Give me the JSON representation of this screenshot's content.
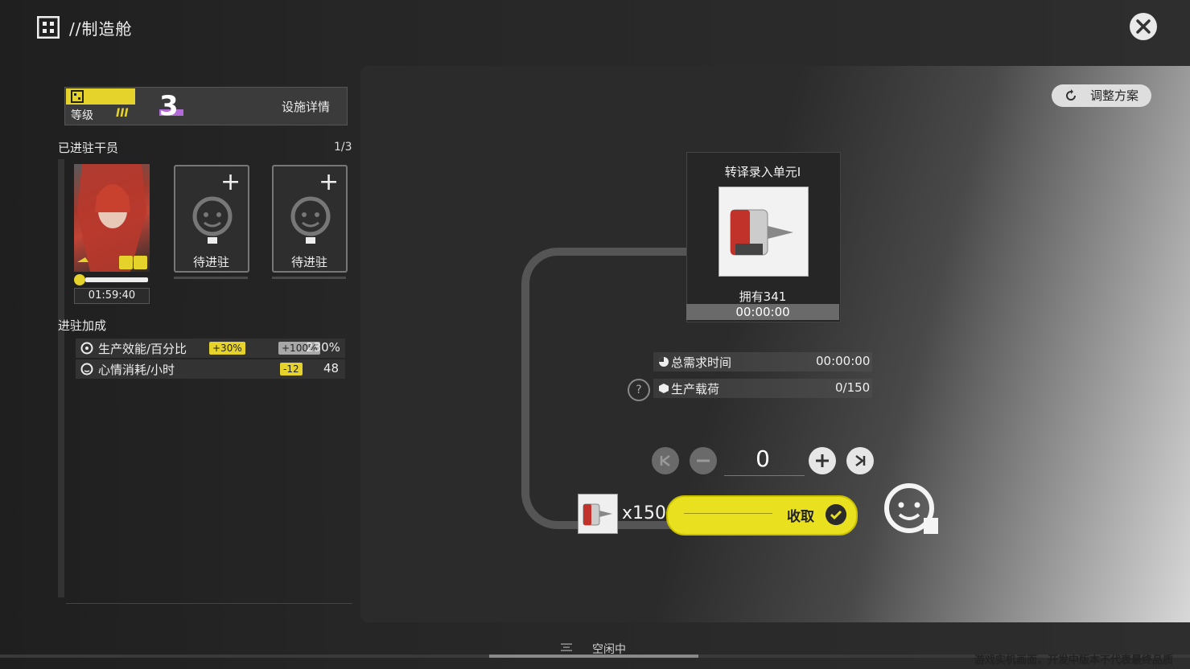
{
  "header": {
    "title": "//制造舱"
  },
  "level": {
    "label": "等级",
    "roman": "III",
    "value": "3",
    "facility_details": "设施详情"
  },
  "operators": {
    "section_title": "已进驻干员",
    "count": "1/3",
    "timer": "01:59:40",
    "slots": [
      {
        "label": "待进驻"
      },
      {
        "label": "待进驻"
      }
    ]
  },
  "bonus": {
    "section_title": "进驻加成",
    "rows": [
      {
        "label": "生产效能/百分比",
        "tag1": "+30%",
        "tag2": "+100%",
        "value": "230%"
      },
      {
        "label": "心情消耗/小时",
        "tag1": "-12",
        "value": "48"
      }
    ]
  },
  "main": {
    "adjust_label": "调整方案",
    "product": {
      "name": "转译录入单元I",
      "owned": "拥有341",
      "time": "00:00:00"
    },
    "stats": [
      {
        "label": "总需求时间",
        "value": "00:00:00"
      },
      {
        "label": "生产载荷",
        "value": "0/150"
      }
    ],
    "help": "?",
    "quantity": "0",
    "output_count": "x150",
    "collect_label": "收取",
    "status": "空闲中"
  },
  "footer": {
    "disclaimer": "游戏实机画面，开发中版本不代表最终品质"
  },
  "colors": {
    "accent_yellow": "#e5d22b",
    "accent_purple": "#b46bd9",
    "panel": "#2b2b2b"
  }
}
